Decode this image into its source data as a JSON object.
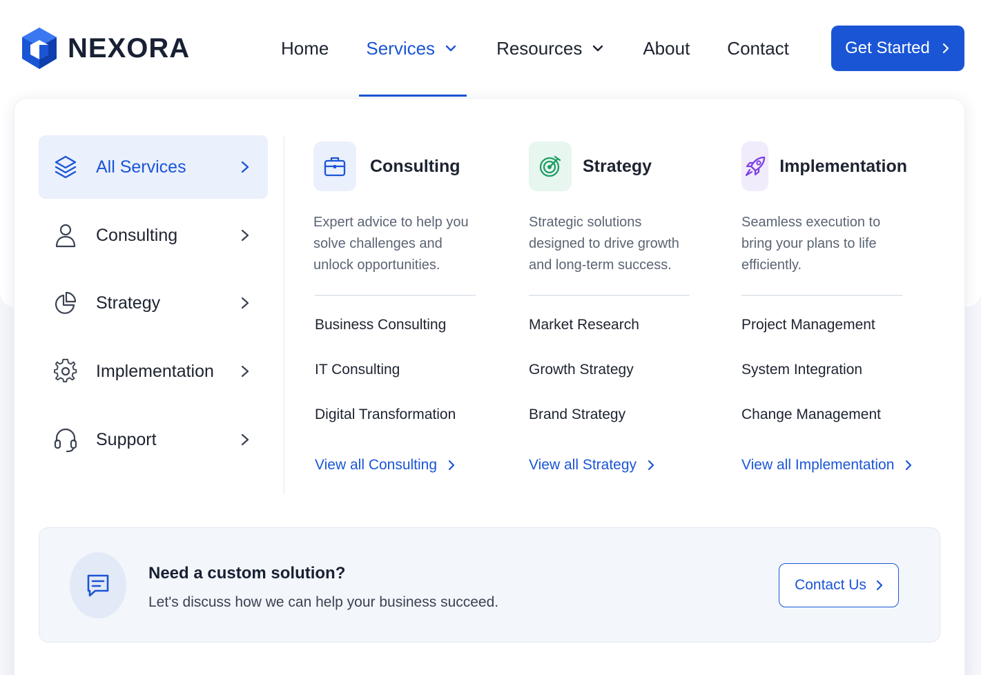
{
  "brand": {
    "name": "NEXORA",
    "logo_icon": "hexagon-cube-logo",
    "accent": "#1a55d6"
  },
  "nav": {
    "items": [
      {
        "label": "Home",
        "has_dropdown": false,
        "active": false
      },
      {
        "label": "Services",
        "has_dropdown": true,
        "active": true
      },
      {
        "label": "Resources",
        "has_dropdown": true,
        "active": false
      },
      {
        "label": "About",
        "has_dropdown": false,
        "active": false
      },
      {
        "label": "Contact",
        "has_dropdown": false,
        "active": false
      }
    ],
    "cta_label": "Get Started"
  },
  "sidebar": {
    "items": [
      {
        "label": "All Services",
        "icon": "layers-icon",
        "active": true
      },
      {
        "label": "Consulting",
        "icon": "user-icon",
        "active": false
      },
      {
        "label": "Strategy",
        "icon": "pie-chart-icon",
        "active": false
      },
      {
        "label": "Implementation",
        "icon": "gear-icon",
        "active": false
      },
      {
        "label": "Support",
        "icon": "headset-icon",
        "active": false
      }
    ]
  },
  "columns": [
    {
      "title": "Consulting",
      "icon": "briefcase-icon",
      "icon_bg": "#eaf0fc",
      "icon_color": "#1a55d6",
      "description": "Expert advice to help you solve challenges and unlock opportunities.",
      "links": [
        "Business Consulting",
        "IT Consulting",
        "Digital Transformation"
      ],
      "view_all": "View all Consulting"
    },
    {
      "title": "Strategy",
      "icon": "target-icon",
      "icon_bg": "#e7f6ef",
      "icon_color": "#1e9e63",
      "description": "Strategic solutions designed to drive growth and long-term success.",
      "links": [
        "Market Research",
        "Growth Strategy",
        "Brand Strategy"
      ],
      "view_all": "View all Strategy"
    },
    {
      "title": "Implementation",
      "icon": "rocket-icon",
      "icon_bg": "#f1ecfb",
      "icon_color": "#7b3fe4",
      "description": "Seamless execution to bring your plans to life efficiently.",
      "links": [
        "Project Management",
        "System Integration",
        "Change Management"
      ],
      "view_all": "View all Implementation"
    }
  ],
  "banner": {
    "icon": "message-icon",
    "title": "Need a custom solution?",
    "subtitle": "Let's discuss how we can help your business succeed.",
    "button_label": "Contact Us"
  }
}
